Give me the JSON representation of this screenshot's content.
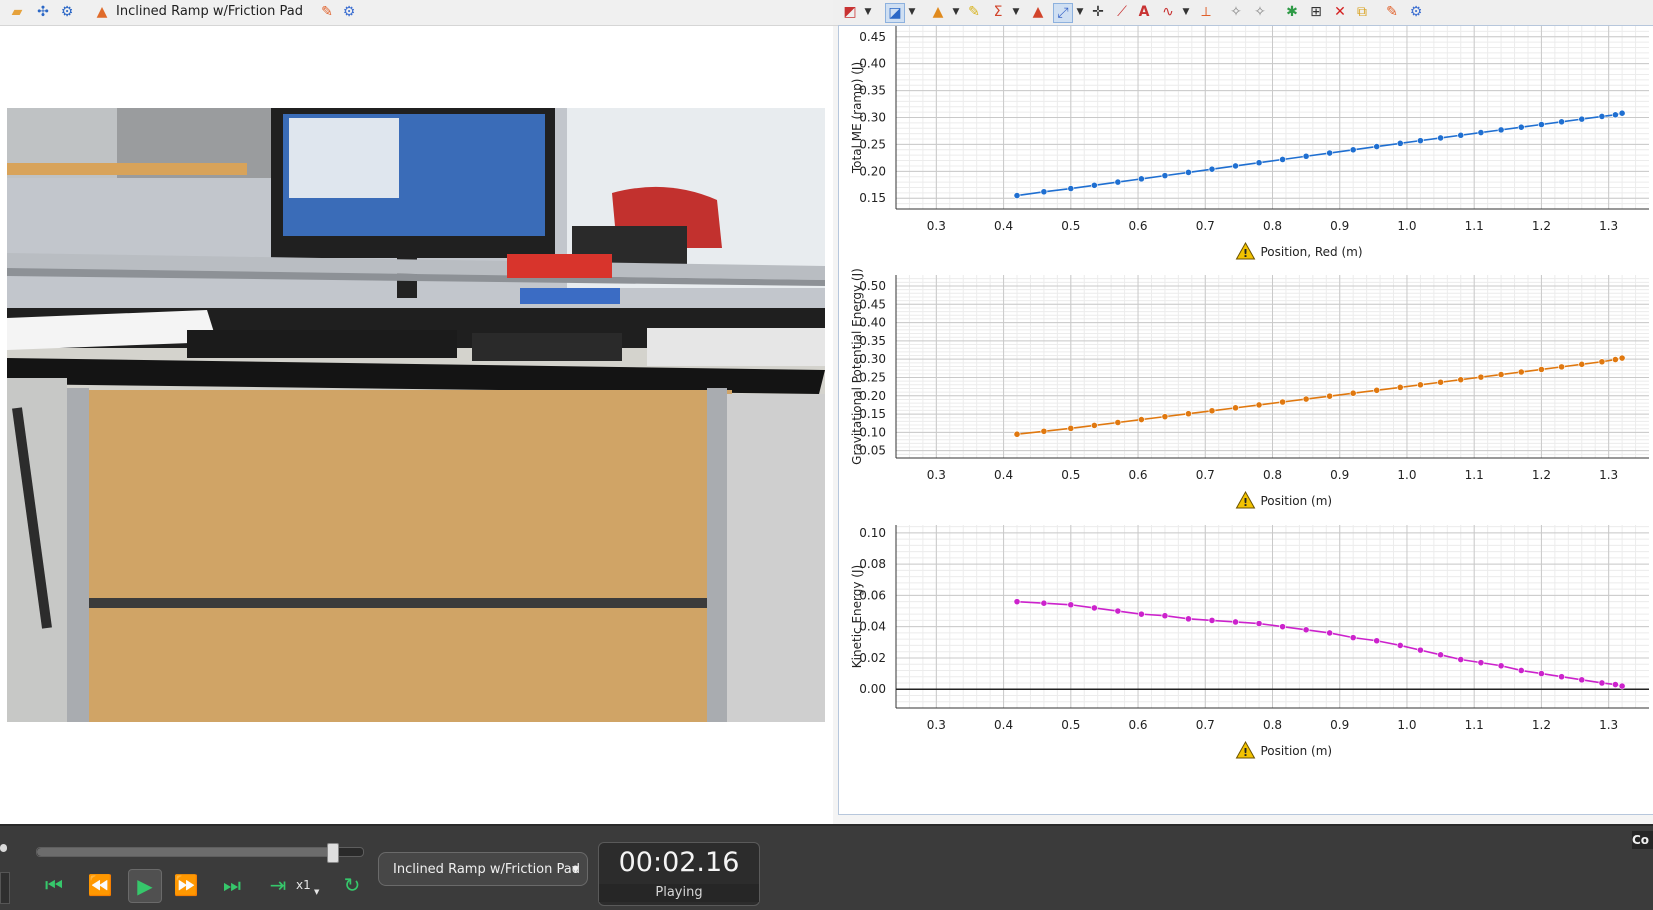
{
  "experiment_name": "Inclined Ramp w/Friction Pad",
  "graphs": [
    {
      "y_label": "Total ME (ramp) (J)",
      "x_label": "Position, Red (m)",
      "y_ticks": [
        "0.15",
        "0.20",
        "0.25",
        "0.30",
        "0.35",
        "0.40",
        "0.45"
      ],
      "x_ticks": [
        "0.3",
        "0.4",
        "0.5",
        "0.6",
        "0.7",
        "0.8",
        "0.9",
        "1.0",
        "1.1",
        "1.2",
        "1.3"
      ],
      "color": "#1f6fd1"
    },
    {
      "y_label": "Gravitational Potential Energy (J)",
      "x_label": "Position (m)",
      "y_ticks": [
        "0.05",
        "0.10",
        "0.15",
        "0.20",
        "0.25",
        "0.30",
        "0.35",
        "0.40",
        "0.45",
        "0.50"
      ],
      "x_ticks": [
        "0.3",
        "0.4",
        "0.5",
        "0.6",
        "0.7",
        "0.8",
        "0.9",
        "1.0",
        "1.1",
        "1.2",
        "1.3"
      ],
      "color": "#e0780f"
    },
    {
      "y_label": "Kinetic Energy (J)",
      "x_label": "Position (m)",
      "y_ticks": [
        "0.00",
        "0.02",
        "0.04",
        "0.06",
        "0.08",
        "0.10"
      ],
      "x_ticks": [
        "0.3",
        "0.4",
        "0.5",
        "0.6",
        "0.7",
        "0.8",
        "0.9",
        "1.0",
        "1.1",
        "1.2",
        "1.3"
      ],
      "color": "#cc22cc"
    }
  ],
  "chart_data": [
    {
      "type": "scatter",
      "ylabel": "Total ME (ramp) (J)",
      "xlabel": "Position, Red (m)",
      "xlim": [
        0.24,
        1.36
      ],
      "ylim": [
        0.13,
        0.47
      ],
      "x": [
        0.42,
        0.46,
        0.5,
        0.535,
        0.57,
        0.605,
        0.64,
        0.675,
        0.71,
        0.745,
        0.78,
        0.815,
        0.85,
        0.885,
        0.92,
        0.955,
        0.99,
        1.02,
        1.05,
        1.08,
        1.11,
        1.14,
        1.17,
        1.2,
        1.23,
        1.26,
        1.29,
        1.31,
        1.32
      ],
      "y": [
        0.155,
        0.162,
        0.168,
        0.174,
        0.18,
        0.186,
        0.192,
        0.198,
        0.204,
        0.21,
        0.216,
        0.222,
        0.228,
        0.234,
        0.24,
        0.246,
        0.252,
        0.257,
        0.262,
        0.267,
        0.272,
        0.277,
        0.282,
        0.287,
        0.292,
        0.297,
        0.302,
        0.305,
        0.308
      ]
    },
    {
      "type": "scatter",
      "ylabel": "Gravitational Potential Energy (J)",
      "xlabel": "Position (m)",
      "xlim": [
        0.24,
        1.36
      ],
      "ylim": [
        0.03,
        0.53
      ],
      "x": [
        0.42,
        0.46,
        0.5,
        0.535,
        0.57,
        0.605,
        0.64,
        0.675,
        0.71,
        0.745,
        0.78,
        0.815,
        0.85,
        0.885,
        0.92,
        0.955,
        0.99,
        1.02,
        1.05,
        1.08,
        1.11,
        1.14,
        1.17,
        1.2,
        1.23,
        1.26,
        1.29,
        1.31,
        1.32
      ],
      "y": [
        0.095,
        0.103,
        0.111,
        0.119,
        0.127,
        0.135,
        0.143,
        0.151,
        0.159,
        0.167,
        0.175,
        0.183,
        0.191,
        0.199,
        0.207,
        0.215,
        0.223,
        0.23,
        0.237,
        0.244,
        0.251,
        0.258,
        0.265,
        0.272,
        0.279,
        0.286,
        0.293,
        0.299,
        0.303
      ]
    },
    {
      "type": "scatter",
      "ylabel": "Kinetic Energy (J)",
      "xlabel": "Position (m)",
      "xlim": [
        0.24,
        1.36
      ],
      "ylim": [
        -0.012,
        0.105
      ],
      "x": [
        0.42,
        0.46,
        0.5,
        0.535,
        0.57,
        0.605,
        0.64,
        0.675,
        0.71,
        0.745,
        0.78,
        0.815,
        0.85,
        0.885,
        0.92,
        0.955,
        0.99,
        1.02,
        1.05,
        1.08,
        1.11,
        1.14,
        1.17,
        1.2,
        1.23,
        1.26,
        1.29,
        1.31,
        1.32
      ],
      "y": [
        0.056,
        0.055,
        0.054,
        0.052,
        0.05,
        0.048,
        0.047,
        0.045,
        0.044,
        0.043,
        0.042,
        0.04,
        0.038,
        0.036,
        0.033,
        0.031,
        0.028,
        0.025,
        0.022,
        0.019,
        0.017,
        0.015,
        0.012,
        0.01,
        0.008,
        0.006,
        0.004,
        0.003,
        0.002
      ]
    }
  ],
  "playback": {
    "speed_label": "x1",
    "time": "00:02.16",
    "status": "Playing",
    "progress": 0.905
  },
  "corner_label": "Co",
  "colors": {
    "accent_green": "#36c76b",
    "control_bg": "#3b3b3b",
    "warning_yellow": "#f2c200"
  }
}
